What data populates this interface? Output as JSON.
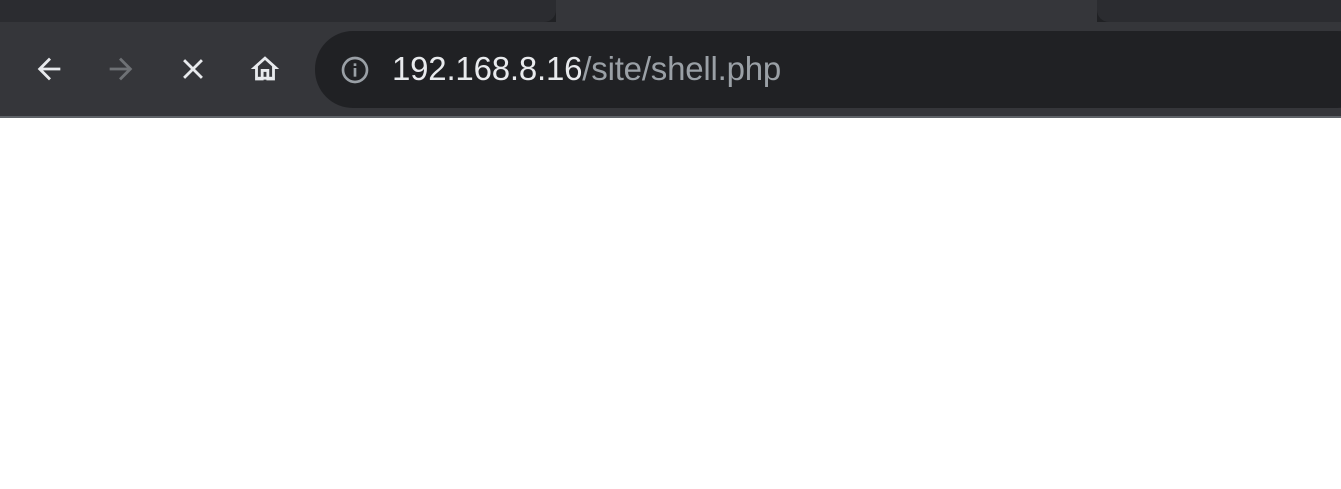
{
  "toolbar": {
    "back_icon": "arrow-left-icon",
    "forward_icon": "arrow-right-icon",
    "stop_icon": "close-icon",
    "home_icon": "home-icon"
  },
  "omnibox": {
    "security_icon": "info-icon",
    "url_host": "192.168.8.16",
    "url_path": "/site/shell.php"
  },
  "colors": {
    "tab_strip_bg": "#202124",
    "toolbar_bg": "#35363a",
    "omnibox_bg": "#202124",
    "url_host": "#e8eaed",
    "url_path": "#9aa0a6",
    "page_bg": "#ffffff"
  }
}
